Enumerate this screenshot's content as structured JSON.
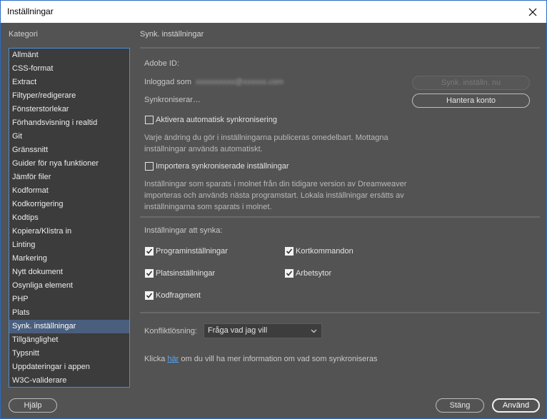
{
  "window": {
    "title": "Inställningar"
  },
  "sidebar": {
    "label": "Kategori",
    "selected_index": 20,
    "items": [
      "Allmänt",
      "CSS-format",
      "Extract",
      "Filtyper/redigerare",
      "Fönsterstorlekar",
      "Förhandsvisning i realtid",
      "Git",
      "Gränssnitt",
      "Guider för nya funktioner",
      "Jämför filer",
      "Kodformat",
      "Kodkorrigering",
      "Kodtips",
      "Kopiera/Klistra in",
      "Linting",
      "Markering",
      "Nytt dokument",
      "Osynliga element",
      "PHP",
      "Plats",
      "Synk. inställningar",
      "Tillgänglighet",
      "Typsnitt",
      "Uppdateringar i appen",
      "W3C-validerare"
    ]
  },
  "main": {
    "title": "Synk. inställningar",
    "adobe_id_label": "Adobe ID:",
    "logged_in_label": "Inloggad som",
    "logged_in_email": "xxxxxxxxxx@xxxxxx.com",
    "sync_status": "Synkroniserar…",
    "sync_now_button": "Synk. inställn. nu",
    "manage_account_button": "Hantera konto",
    "auto_sync": {
      "label": "Aktivera automatisk synkronisering",
      "checked": false,
      "description": "Varje ändring du gör i inställningarna publiceras omedelbart. Mottagna inställningar används automatiskt."
    },
    "import_sync": {
      "label": "Importera synkroniserade inställningar",
      "checked": false,
      "description": "Inställningar som sparats i molnet från din tidigare version av Dreamweaver importeras och används nästa programstart. Lokala inställningar ersätts av inställningarna som sparats i molnet."
    },
    "settings_to_sync_label": "Inställningar att synka:",
    "sync_options": [
      {
        "label": "Programinställningar",
        "checked": true
      },
      {
        "label": "Kortkommandon",
        "checked": true
      },
      {
        "label": "Platsinställningar",
        "checked": true
      },
      {
        "label": "Arbetsytor",
        "checked": true
      },
      {
        "label": "Kodfragment",
        "checked": true
      }
    ],
    "conflict_label": "Konfliktlösning:",
    "conflict_value": "Fråga vad jag vill",
    "info_prefix": "Klicka ",
    "info_link": "här",
    "info_suffix": " om du vill ha mer information om vad som synkroniseras"
  },
  "footer": {
    "help_button": "Hjälp",
    "close_button": "Stäng",
    "apply_button": "Använd"
  }
}
